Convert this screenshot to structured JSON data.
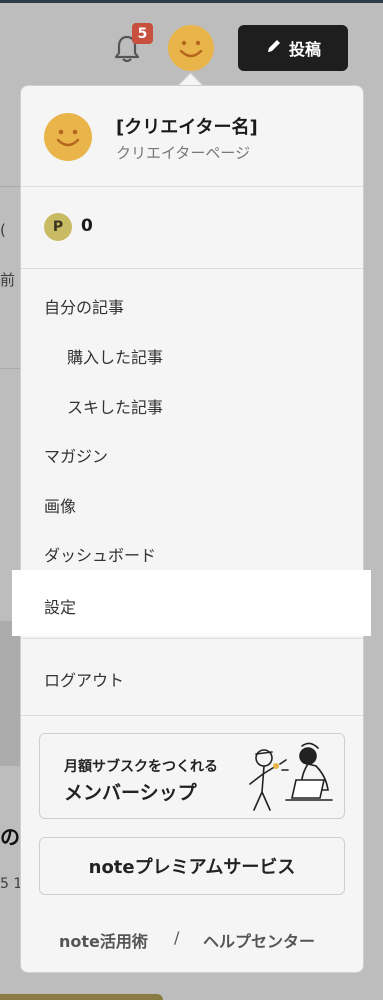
{
  "header": {
    "notification_count": "5",
    "post_button_label": "投稿"
  },
  "background": {
    "text_a": "(",
    "text_b": "前",
    "title_fragment": "の",
    "date_fragment": "5 1"
  },
  "profile": {
    "name": "[クリエイター名]",
    "subtitle": "クリエイターページ",
    "points": "0",
    "point_icon": "P"
  },
  "menu": {
    "my_articles": "自分の記事",
    "purchased": "購入した記事",
    "liked": "スキした記事",
    "magazine": "マガジン",
    "images": "画像",
    "dashboard": "ダッシュボード",
    "settings": "設定",
    "logout": "ログアウト"
  },
  "promo": {
    "line1": "月額サブスクをつくれる",
    "line2": "メンバーシップ"
  },
  "premium_label": "noteプレミアムサービス",
  "footer": {
    "link1": "note活用術",
    "separator": "/",
    "link2": "ヘルプセンター"
  },
  "colors": {
    "badge": "#c8503e",
    "avatar": "#e9b54a",
    "post_button": "#1e1e1e",
    "panel": "#f5f5f5"
  },
  "icons": [
    "bell-icon",
    "pencil-icon",
    "smiley-avatar-icon",
    "point-icon"
  ]
}
